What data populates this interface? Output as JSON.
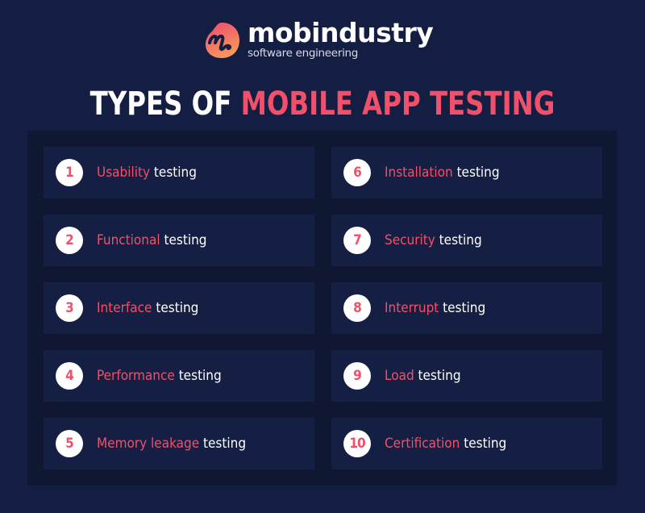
{
  "brand": {
    "name": "mobindustry",
    "tagline": "software engineering",
    "logo_icon": "mobindustry-logo-icon",
    "colors": {
      "background": "#141e42",
      "panel": "#0f1732",
      "card": "#151f44",
      "accent": "#f0506a",
      "logo_gradient_top": "#ee4a73",
      "logo_gradient_bottom": "#f7955a",
      "text": "#ffffff"
    }
  },
  "title": {
    "part1": "TYPES OF",
    "part2": "MOBILE APP TESTING"
  },
  "items": [
    {
      "number": "1",
      "highlight": "Usability",
      "rest": "testing"
    },
    {
      "number": "2",
      "highlight": "Functional",
      "rest": "testing"
    },
    {
      "number": "3",
      "highlight": "Interface",
      "rest": "testing"
    },
    {
      "number": "4",
      "highlight": "Performance",
      "rest": "testing"
    },
    {
      "number": "5",
      "highlight": "Memory leakage",
      "rest": "testing"
    },
    {
      "number": "6",
      "highlight": "Installation",
      "rest": "testing"
    },
    {
      "number": "7",
      "highlight": "Security",
      "rest": "testing"
    },
    {
      "number": "8",
      "highlight": "Interrupt",
      "rest": "testing"
    },
    {
      "number": "9",
      "highlight": "Load",
      "rest": "testing"
    },
    {
      "number": "10",
      "highlight": "Certification",
      "rest": "testing"
    }
  ]
}
